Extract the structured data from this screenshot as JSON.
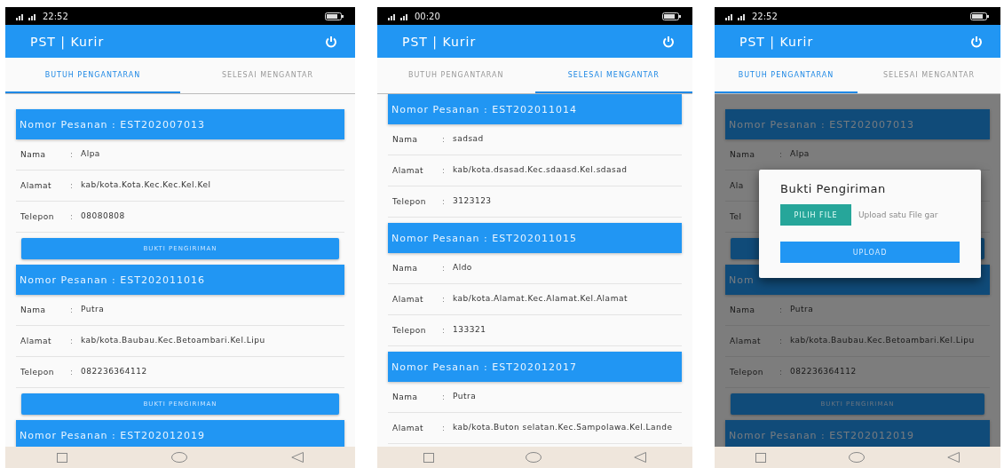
{
  "phones": [
    {
      "status_bar": {
        "time": "22:52"
      },
      "app_bar": {
        "title": "PST | Kurir"
      },
      "tabs": [
        {
          "label": "BUTUH PENGANTARAN",
          "selected": true
        },
        {
          "label": "SELESAI MENGANTAR",
          "selected": false
        }
      ],
      "orders": [
        {
          "header": "Nomor Pesanan : EST202007013",
          "fields": [
            {
              "label": "Nama",
              "separator": ":",
              "value": "Alpa"
            },
            {
              "label": "Alamat",
              "separator": ":",
              "value": "kab/kota.Kota.Kec.Kec.Kel.Kel"
            },
            {
              "label": "Telepon",
              "separator": ":",
              "value": "08080808"
            }
          ],
          "button": {
            "label": "BUKTI PENGIRIMAN"
          }
        },
        {
          "header": "Nomor Pesanan : EST202011016",
          "fields": [
            {
              "label": "Nama",
              "separator": ":",
              "value": "Putra"
            },
            {
              "label": "Alamat",
              "separator": ":",
              "value": "kab/kota.Baubau.Kec.Betoambari.Kel.Lipu"
            },
            {
              "label": "Telepon",
              "separator": ":",
              "value": "082236364112"
            }
          ],
          "button": {
            "label": "BUKTI PENGIRIMAN"
          }
        },
        {
          "header": "Nomor Pesanan : EST202012019"
        }
      ]
    },
    {
      "status_bar": {
        "time": "00:20"
      },
      "app_bar": {
        "title": "PST | Kurir"
      },
      "tabs": [
        {
          "label": "BUTUH PENGANTARAN",
          "selected": false
        },
        {
          "label": "SELESAI MENGANTAR",
          "selected": true
        }
      ],
      "orders": [
        {
          "header": "Nomor Pesanan : EST202011014",
          "fields": [
            {
              "label": "Nama",
              "separator": ":",
              "value": "sadsad"
            },
            {
              "label": "Alamat",
              "separator": ":",
              "value": "kab/kota.dsasad.Kec.sdaasd.Kel.sdasad"
            },
            {
              "label": "Telepon",
              "separator": ":",
              "value": "3123123"
            }
          ]
        },
        {
          "header": "Nomor Pesanan : EST202011015",
          "fields": [
            {
              "label": "Nama",
              "separator": ":",
              "value": "Aldo"
            },
            {
              "label": "Alamat",
              "separator": ":",
              "value": "kab/kota.Alamat.Kec.Alamat.Kel.Alamat"
            },
            {
              "label": "Telepon",
              "separator": ":",
              "value": "133321"
            }
          ]
        },
        {
          "header": "Nomor Pesanan : EST202012017",
          "fields": [
            {
              "label": "Nama",
              "separator": ":",
              "value": "Putra"
            },
            {
              "label": "Alamat",
              "separator": ":",
              "value": "kab/kota.Buton selatan.Kec.Sampolawa.Kel.Lande"
            }
          ]
        }
      ]
    },
    {
      "status_bar": {
        "time": "22:52"
      },
      "app_bar": {
        "title": "PST | Kurir"
      },
      "tabs": [
        {
          "label": "BUTUH PENGANTARAN",
          "selected": true
        },
        {
          "label": "SELESAI MENGANTAR",
          "selected": false
        }
      ],
      "orders": [
        {
          "header": "Nomor Pesanan : EST202007013",
          "fields": [
            {
              "label": "Nama",
              "separator": ":",
              "value": "Alpa"
            },
            {
              "label": "Ala"
            },
            {
              "label": "Tel"
            }
          ],
          "button": true
        },
        {
          "header": "Nom",
          "fields": [
            {
              "label": "Nama",
              "separator": ":",
              "value": "Putra"
            },
            {
              "label": "Alamat",
              "separator": ":",
              "value": "kab/kota.Baubau.Kec.Betoambari.Kel.Lipu"
            },
            {
              "label": "Telepon",
              "separator": ":",
              "value": "082236364112"
            }
          ],
          "button": {
            "label": "BUKTI PENGIRIMAN"
          }
        },
        {
          "header": "Nomor Pesanan : EST202012019"
        }
      ],
      "dialog": {
        "title": "Bukti Pengiriman",
        "choose_button": "PILIH FILE",
        "file_field": {
          "placeholder": "Upload satu File gar"
        },
        "upload_button": "UPLOAD"
      }
    }
  ]
}
